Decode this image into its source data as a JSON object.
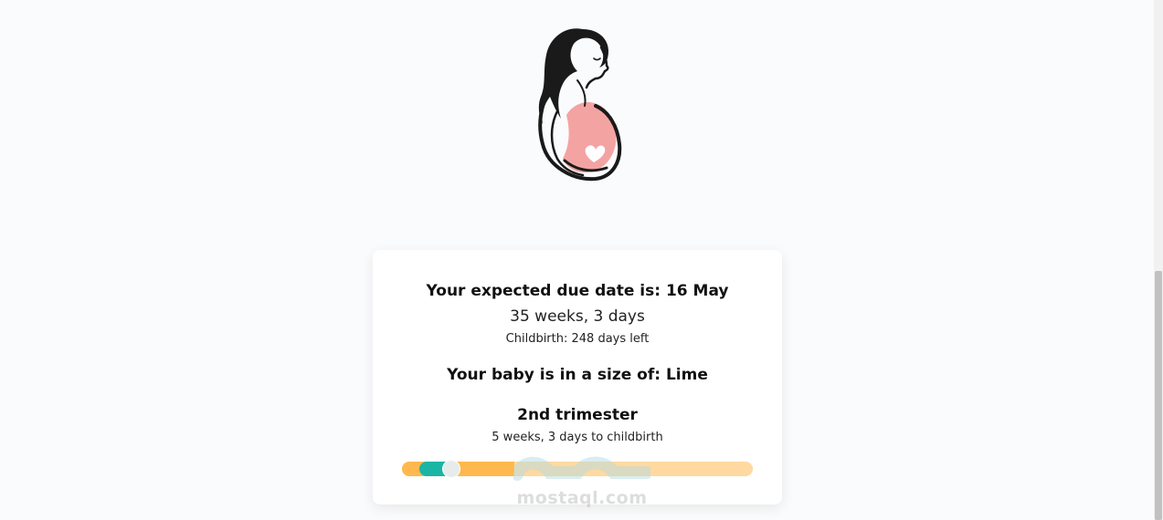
{
  "logo": {
    "icon": "pregnant-woman-icon",
    "belly_color": "#f4a3a3"
  },
  "card": {
    "due_date": "Your expected due date is: 16 May",
    "weeks": "35 weeks, 3 days",
    "days_left": "Childbirth: 248 days left",
    "baby_size": "Your baby is in a size of: Lime",
    "trimester": "2nd trimester",
    "to_childbirth": "5 weeks, 3 days to childbirth"
  },
  "progress": {
    "completed_fraction": 0.32,
    "current_marker_fraction": 0.12,
    "colors": {
      "done": "#ffb84d",
      "remaining": "#ffd9a0",
      "current": "#1ab5a4",
      "knob": "#e6eceb"
    }
  },
  "watermark": {
    "text": "mostaql.com"
  }
}
